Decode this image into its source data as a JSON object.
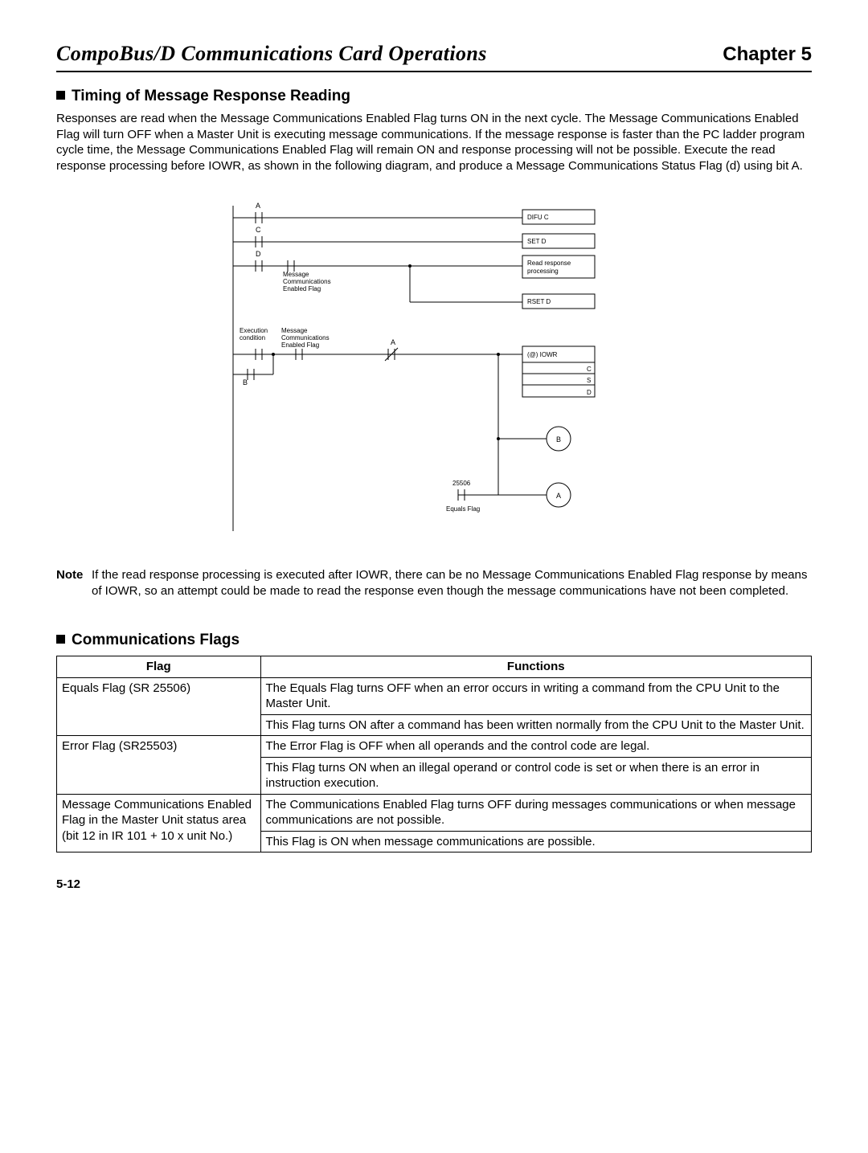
{
  "header": {
    "left": "CompoBus/D Communications Card Operations",
    "right": "Chapter 5"
  },
  "sections": {
    "timing": {
      "heading": "Timing of Message Response Reading",
      "paragraph": "Responses are read when the Message Communications Enabled Flag turns ON in the next cycle. The Message Communications Enabled Flag will turn OFF when a Master Unit is executing message communications. If the message response is faster than the PC ladder program cycle time, the Message Communications Enabled Flag will remain ON and response processing will not be possible. Execute the read response processing before IOWR, as shown in the following diagram, and produce a Message Communications Status Flag (d) using bit A."
    },
    "note": {
      "label": "Note",
      "text": "If the read response processing is executed after IOWR, there can be no Message Communications Enabled Flag response by means of IOWR, so an attempt could be made to read the response even though the message communications have not been completed."
    },
    "comm_flags_heading": "Communications Flags"
  },
  "diagram": {
    "labels": {
      "A": "A",
      "C": "C",
      "D": "D",
      "B": "B",
      "msg_comm_enabled": "Message\nCommunications\nEnabled Flag",
      "exec_cond": "Execution\ncondition",
      "msg_comm_enabled2": "Message\nCommunications\nEnabled Flag",
      "A2": "A",
      "difu_c": "DIFU C",
      "set_d": "SET D",
      "read_resp": "Read response\nprocessing",
      "rset_d": "RSET D",
      "iowr": "(@) IOWR",
      "iowr_c": "C",
      "iowr_s": "S",
      "iowr_d": "D",
      "circle_b": "B",
      "val25506": "25506",
      "circle_a": "A",
      "equals_flag": "Equals Flag"
    }
  },
  "table": {
    "headers": {
      "flag": "Flag",
      "functions": "Functions"
    },
    "rows": [
      {
        "flag": "Equals Flag (SR 25506)",
        "func1": "The Equals Flag turns OFF when an error occurs in writing a command from the CPU Unit to the Master Unit.",
        "func2": "This Flag turns ON after a command has been written normally from the CPU Unit to the Master Unit."
      },
      {
        "flag": "Error Flag (SR25503)",
        "func1": "The Error Flag is OFF when all operands and the control code are legal.",
        "func2": "This Flag turns ON when an illegal operand or control code is set or when there is an error in instruction execution."
      },
      {
        "flag": "Message Communications Enabled Flag in the Master Unit status area (bit 12 in IR 101 + 10 x unit No.)",
        "func1": "The Communications Enabled Flag turns OFF during messages communications or when message communications are not possible.",
        "func2": "This Flag is ON when message communications are possible."
      }
    ]
  },
  "page_number": "5-12"
}
